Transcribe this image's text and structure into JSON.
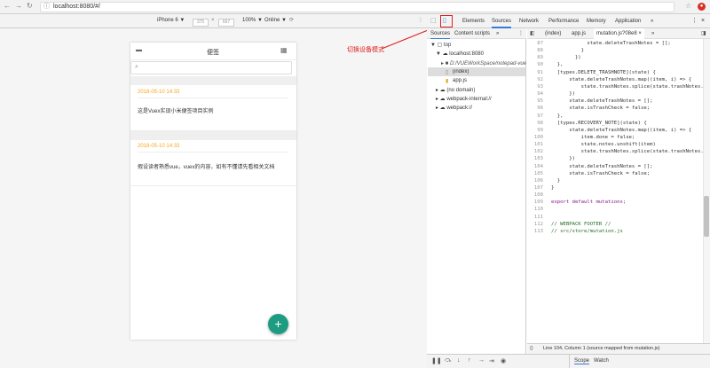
{
  "browser": {
    "url": "localhost:8080/#/",
    "back_icon": "arrow-left",
    "forward_icon": "arrow-right",
    "reload_icon": "reload"
  },
  "device_toolbar": {
    "device": "iPhone 6 ▼",
    "width": "375",
    "times": "×",
    "height": "667",
    "zoom": "100% ▼",
    "network": "Online ▼"
  },
  "app": {
    "title": "便签",
    "search_placeholder": "",
    "notes": [
      {
        "date": "2018-05-10 14:33",
        "text": "这是Vuex实现小米便签项目实例"
      },
      {
        "date": "2018-05-10 14:33",
        "text": "假设读者熟悉vue，vuex的内容，如有不懂请先看相关文档"
      }
    ],
    "fab_label": "+"
  },
  "annotation": {
    "text": "切换设备模式",
    "color": "#e02020"
  },
  "devtools": {
    "tabs": [
      "Elements",
      "Sources",
      "Network",
      "Performance",
      "Memory",
      "Application",
      "»"
    ],
    "active_tab": "Sources",
    "nav_subtabs": [
      "Sources",
      "Content scripts",
      "»"
    ],
    "tree": [
      "▼ ▢ top",
      "▼ ☁ localhost:8080",
      "▸ ■ D:/VUEWorkSpace/notepad-vue",
      "(index)",
      "app.js",
      "▸ ☁ (no domain)",
      "▸ ☁ webpack-internal://",
      "▸ ☁ webpack://"
    ],
    "editor_tabs": [
      "(index)",
      "app.js",
      "mutation.js?08e8 ×",
      "»"
    ],
    "code_lines": [
      {
        "n": "87",
        "t": "            state.deleteTrashNotes = [];"
      },
      {
        "n": "88",
        "t": "          }"
      },
      {
        "n": "89",
        "t": "        })"
      },
      {
        "n": "90",
        "t": "  },"
      },
      {
        "n": "91",
        "t": "  [types.DELETE_TRASHNOTE](state) {"
      },
      {
        "n": "92",
        "t": "      state.deleteTrashNotes.map((item, i) => {"
      },
      {
        "n": "93",
        "t": "          state.trashNotes.splice(state.trashNotes.i"
      },
      {
        "n": "94",
        "t": "      })"
      },
      {
        "n": "95",
        "t": "      state.deleteTrashNotes = [];"
      },
      {
        "n": "96",
        "t": "      state.isTrashCheck = false;"
      },
      {
        "n": "97",
        "t": "  },"
      },
      {
        "n": "98",
        "t": "  [types.RECOVERY_NOTE](state) {"
      },
      {
        "n": "99",
        "t": "      state.deleteTrashNotes.map((item, i) => {"
      },
      {
        "n": "100",
        "t": "          item.done = false;"
      },
      {
        "n": "101",
        "t": "          state.notes.unshift(item)"
      },
      {
        "n": "102",
        "t": "          state.trashNotes.splice(state.trashNotes.i"
      },
      {
        "n": "103",
        "t": "      })"
      },
      {
        "n": "104",
        "t": "      state.deleteTrashNotes = [];"
      },
      {
        "n": "105",
        "t": "      state.isTrashCheck = false;"
      },
      {
        "n": "106",
        "t": "  }"
      },
      {
        "n": "107",
        "t": "}"
      },
      {
        "n": "108",
        "t": ""
      },
      {
        "n": "109",
        "t": "export default mutations;"
      },
      {
        "n": "110",
        "t": ""
      },
      {
        "n": "111",
        "t": ""
      },
      {
        "n": "112",
        "t": "// WEBPACK FOOTER //"
      },
      {
        "n": "113",
        "t": "// src/store/mutation.js"
      }
    ],
    "status": "Line 104, Column 1   (source mapped from mutation.js)",
    "scope_tabs": [
      "Scope",
      "Watch"
    ]
  }
}
